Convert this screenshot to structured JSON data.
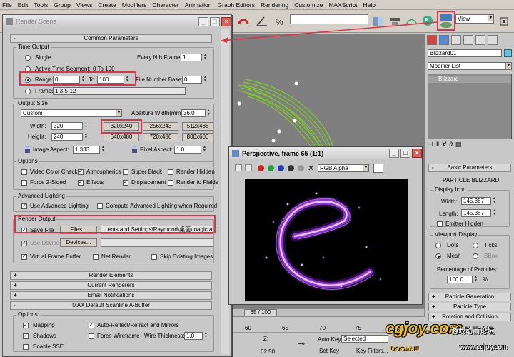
{
  "menubar": {
    "items": [
      "File",
      "Edit",
      "Tools",
      "Group",
      "Views",
      "Create",
      "Modifiers",
      "Character",
      "Animation",
      "Graph Editors",
      "Rendering",
      "Customize",
      "MAXScript",
      "Help"
    ]
  },
  "toolbar": {
    "view_dropdown": "View"
  },
  "render_dialog": {
    "title": "Render Scene",
    "common_parameters": "Common Parameters",
    "time_output": {
      "title": "Time Output",
      "single": "Single",
      "every_nth_frame": "Every Nth Frame:",
      "every_nth_value": "1",
      "active_time_segment": "Active Time Segment:",
      "active_time_value": "0 To 100",
      "range": "Range:",
      "range_from": "0",
      "range_to_label": "To",
      "range_to": "100",
      "file_number_base": "File Number Base:",
      "file_number_value": "0",
      "frames": "Frames",
      "frames_value": "1,3,5-12"
    },
    "output_size": {
      "title": "Output Size",
      "preset": "Custom",
      "aperture_label": "Aperture Width(mm):",
      "aperture_value": "36.0",
      "width_label": "Width:",
      "width_value": "320",
      "height_label": "Height:",
      "height_value": "240",
      "presets": [
        "320x240",
        "256x243",
        "512x486",
        "640x480",
        "720x486",
        "800x600"
      ],
      "image_aspect_label": "Image Aspect:",
      "image_aspect_value": "1.333",
      "pixel_aspect_label": "Pixel Aspect:",
      "pixel_aspect_value": "1.0"
    },
    "options": {
      "title": "Options",
      "video_color_check": "Video Color Check",
      "atmospherics": "Atmospherics",
      "super_black": "Super Black",
      "render_hidden": "Render Hidden",
      "force_2sided": "Force 2-Sided",
      "effects": "Effects",
      "displacement": "Displacement",
      "render_to_fields": "Render to Fields"
    },
    "advanced_lighting": {
      "title": "Advanced Lighting",
      "use": "Use Advanced Lighting",
      "compute": "Compute Advanced Lighting when Required"
    },
    "render_output": {
      "title": "Render Output",
      "save_file": "Save File",
      "files_button": "Files...",
      "path": "...ents and Settings\\Raymond\\桌面\\magic.avi",
      "use_device": "Use Device",
      "devices_button": "Devices...",
      "virtual_frame_buffer": "Virtual Frame Buffer",
      "net_render": "Net Render",
      "skip_existing": "Skip Existing Images"
    },
    "rollouts": [
      "Render Elements",
      "Current Renderers",
      "Email Notifications",
      "MAX Default Scanline A-Buffer"
    ],
    "scanline_options": {
      "title": "Options:",
      "mapping": "Mapping",
      "auto_reflect": "Auto-Reflect/Refract and Mirrors",
      "shadows": "Shadows",
      "force_wireframe": "Force Wireframe",
      "wire_thickness_label": "Wire Thickness:",
      "wire_thickness_value": "1.0",
      "enable_sse": "Enable SSE"
    }
  },
  "perspective_window": {
    "title": "Perspective, frame 65 (1:1)",
    "channel": "RGB Alpha"
  },
  "command_panel": {
    "object_name": "Blizzard01",
    "modifier_list": "Modifier List",
    "stack_item": "Blizzard",
    "basic_parameters": "Basic Parameters",
    "particle_label": "PARTICLE BLIZZARD",
    "display_icon": "Display Icon",
    "width_label": "Width:",
    "width_value": "145.387",
    "length_label": "Length:",
    "length_value": "145.387",
    "emitter_hidden": "Emitter Hidden",
    "viewport_display": "Viewport Display",
    "dots": "Dots",
    "ticks": "Ticks",
    "mesh": "Mesh",
    "bbox": "BBox",
    "percentage_label": "Percentage of Particles:",
    "percentage_value": "100.0",
    "percent_sign": "%",
    "rollouts": [
      "Particle Generation",
      "Particle Type",
      "Rotation and Collision"
    ]
  },
  "timeline": {
    "frame_counter": "65 / 100",
    "ticks": [
      "60",
      "65",
      "70",
      "75",
      "80"
    ]
  },
  "status": {
    "z_label": "Z:",
    "coord_value": "62.50",
    "auto_key": "Auto Key",
    "selected": "Selected",
    "set_key": "Set Key",
    "key_filters": "Key Filters..."
  },
  "watermark": {
    "logo": "cgjoy.com",
    "forum": "游戏动画论坛",
    "url": "www.cgjoy.com",
    "sub": "DOGAME"
  },
  "colors": {
    "highlight": "#e0304a",
    "particle_green": "#7ed321",
    "particle_purple": "#b44cff"
  }
}
